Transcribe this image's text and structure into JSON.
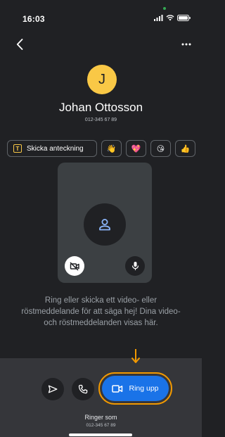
{
  "status_bar": {
    "time": "16:03"
  },
  "contact": {
    "initial": "J",
    "name": "Johan Ottosson",
    "number": "012-345 67 89"
  },
  "quick_actions": {
    "note_label": "Skicka anteckning",
    "reactions": [
      "👋",
      "💖",
      "😘",
      "👍"
    ]
  },
  "info_text": "Ring eller skicka ett video- eller röstmeddelande för att säga hej! Dina video- och röstmeddelanden visas här.",
  "bottom_bar": {
    "call_label": "Ring upp",
    "ringer_label": "Ringer som",
    "ringer_number": "012-345 67 89"
  },
  "colors": {
    "background": "#202124",
    "avatar": "#f9c846",
    "call_button": "#1a73e8",
    "highlight": "#f29900"
  }
}
